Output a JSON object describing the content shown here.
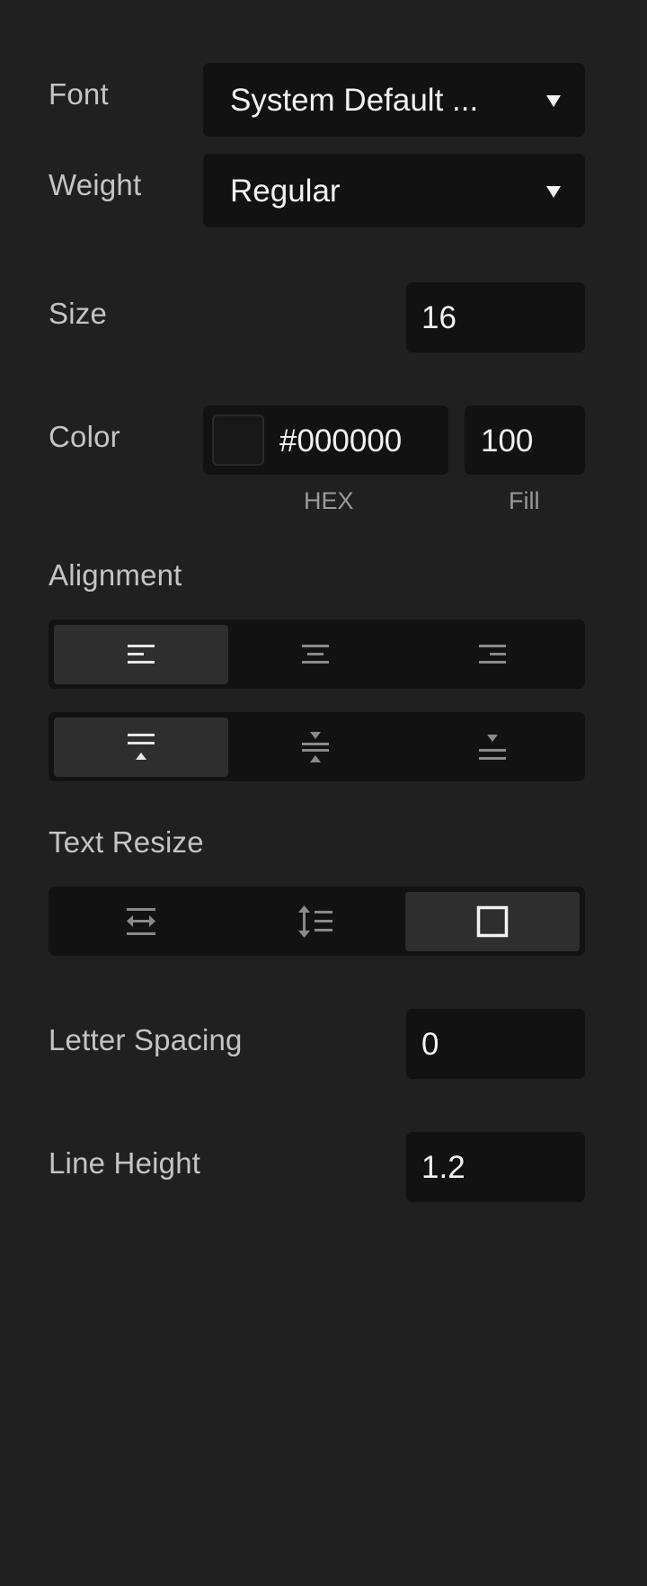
{
  "font": {
    "label": "Font",
    "value": "System Default ..."
  },
  "weight": {
    "label": "Weight",
    "value": "Regular"
  },
  "size": {
    "label": "Size",
    "value": "16"
  },
  "color": {
    "label": "Color",
    "hex": "#000000",
    "fill": "100",
    "hex_caption": "HEX",
    "fill_caption": "Fill",
    "swatch": "#181818"
  },
  "alignment": {
    "label": "Alignment",
    "horizontal": [
      "align-left-icon",
      "align-center-icon",
      "align-right-icon"
    ],
    "horizontal_selected": "align-left",
    "vertical": [
      "align-top-icon",
      "align-middle-icon",
      "align-bottom-icon"
    ],
    "vertical_selected": "align-top"
  },
  "text_resize": {
    "label": "Text Resize",
    "options": [
      "auto-width-icon",
      "auto-height-icon",
      "fixed-size-icon"
    ],
    "selected": "fixed-size"
  },
  "letter_spacing": {
    "label": "Letter Spacing",
    "value": "0"
  },
  "line_height": {
    "label": "Line Height",
    "value": "1.2"
  },
  "colors": {
    "background": "#202020",
    "field": "#121212",
    "active_segment": "#2e2e2e",
    "text": "#f2f2f2",
    "label": "#c4c4c4"
  }
}
